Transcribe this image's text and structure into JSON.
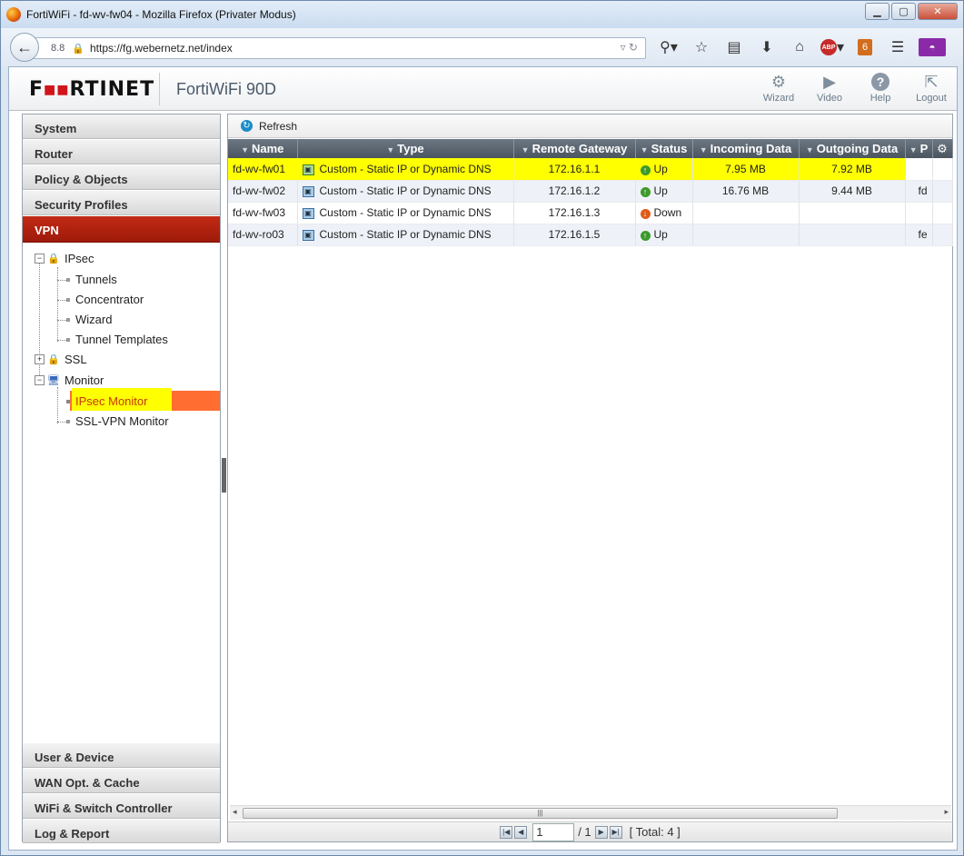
{
  "browser": {
    "window_title": "FortiWiFi - fd-wv-fw04 - Mozilla Firefox (Privater Modus)",
    "zoom_text": "8.8",
    "url": "https://fg.webernetz.net/index",
    "badge_count": "6"
  },
  "header": {
    "logo_left": "F",
    "logo_mid": "■■",
    "logo_right": "RTINET",
    "model": "FortiWiFi 90D",
    "buttons": {
      "wizard": "Wizard",
      "video": "Video",
      "help": "Help",
      "logout": "Logout"
    }
  },
  "sidebar": {
    "sections_top": {
      "system": "System",
      "router": "Router",
      "policy": "Policy & Objects",
      "security": "Security Profiles",
      "vpn": "VPN"
    },
    "tree": {
      "ipsec": "IPsec",
      "tunnels": "Tunnels",
      "concentrator": "Concentrator",
      "wizard": "Wizard",
      "tunnel_templates": "Tunnel Templates",
      "ssl": "SSL",
      "monitor": "Monitor",
      "ipsec_monitor": "IPsec Monitor",
      "sslvpn_monitor": "SSL-VPN Monitor"
    },
    "sections_bottom": {
      "user": "User & Device",
      "wan": "WAN Opt. & Cache",
      "wifi": "WiFi & Switch Controller",
      "log": "Log & Report"
    }
  },
  "main": {
    "refresh_label": "Refresh",
    "columns": {
      "name": "Name",
      "type": "Type",
      "gateway": "Remote Gateway",
      "status": "Status",
      "incoming": "Incoming Data",
      "outgoing": "Outgoing Data",
      "p": "P"
    },
    "rows": [
      {
        "name": "fd-wv-fw01",
        "type": "Custom - Static IP or Dynamic DNS",
        "gateway": "172.16.1.1",
        "status": "Up",
        "incoming": "7.95 MB",
        "outgoing": "7.92 MB",
        "p": ""
      },
      {
        "name": "fd-wv-fw02",
        "type": "Custom - Static IP or Dynamic DNS",
        "gateway": "172.16.1.2",
        "status": "Up",
        "incoming": "16.76 MB",
        "outgoing": "9.44 MB",
        "p": "fd"
      },
      {
        "name": "fd-wv-fw03",
        "type": "Custom - Static IP or Dynamic DNS",
        "gateway": "172.16.1.3",
        "status": "Down",
        "incoming": "",
        "outgoing": "",
        "p": ""
      },
      {
        "name": "fd-wv-ro03",
        "type": "Custom - Static IP or Dynamic DNS",
        "gateway": "172.16.1.5",
        "status": "Up",
        "incoming": "",
        "outgoing": "",
        "p": "fe"
      }
    ],
    "pager": {
      "page": "1",
      "of": "/ 1",
      "total": "[ Total: 4 ]"
    }
  },
  "colors": {
    "vpn_active": "#b2200f",
    "selected_item": "#ff6d31",
    "highlight": "#ffff00",
    "header_bg": "#4b5560"
  },
  "icons": [
    "firefox-icon",
    "back-icon",
    "lock-icon",
    "reload-icon",
    "search-icon",
    "star-icon",
    "reading-list-icon",
    "download-icon",
    "home-icon",
    "adblock-icon",
    "menu-icon",
    "private-mask-icon",
    "wizard-icon",
    "video-icon",
    "help-icon",
    "logout-icon",
    "refresh-icon",
    "filter-icon",
    "gear-icon",
    "status-up-icon",
    "status-down-icon"
  ]
}
